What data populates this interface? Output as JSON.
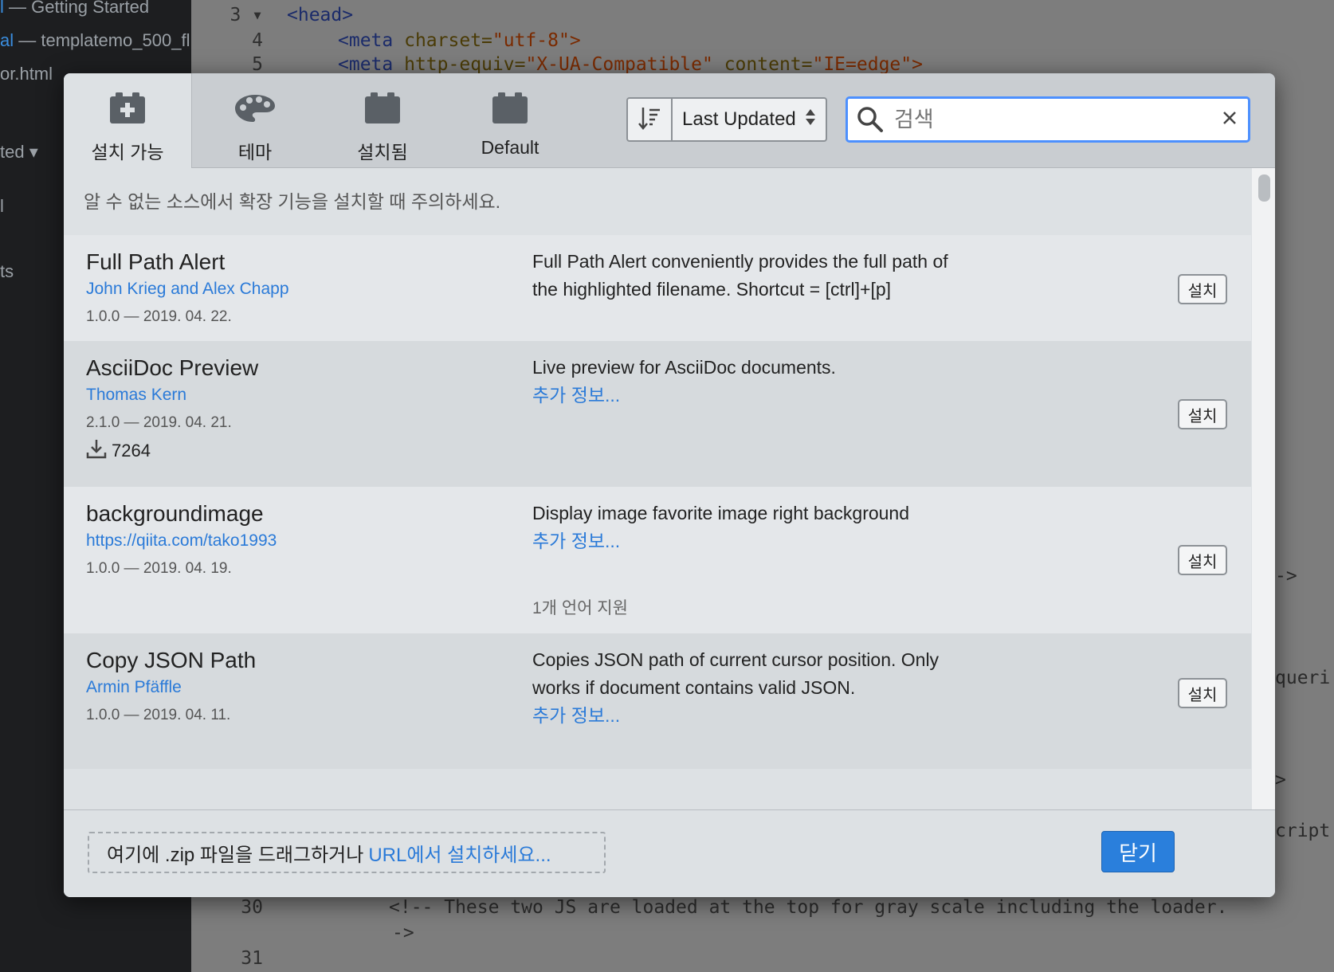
{
  "background": {
    "sidebar": [
      {
        "prefix": "l",
        "text": " — Getting Started"
      },
      {
        "prefix": "al",
        "text": " — templatemo_500_fl"
      },
      {
        "prefix": "",
        "text": "or.html"
      },
      {
        "prefix": "",
        "text": "ted ▾"
      },
      {
        "prefix": "",
        "text": "l"
      },
      {
        "prefix": "",
        "text": "ts"
      }
    ],
    "code": {
      "line3_num": "3 ▾",
      "line3": "<head>",
      "line4_num": "4",
      "line4_tag": "<meta",
      "line4_attr": "charset=",
      "line4_str": "\"utf-8\">",
      "line5_num": "5",
      "line5_tag": "<meta",
      "line5_attr": "http-equiv=",
      "line5_str1": "\"X-UA-Compatible\"",
      "line5_attr2": "content=",
      "line5_str2": "\"IE=edge\">",
      "line30_num": "30",
      "line30": "<!-- These two JS are loaded at the top for gray scale including the loader.",
      "line30b": "->",
      "line31_num": "31",
      "edge1": "->",
      "edge2": "queri",
      "edge3": ">",
      "edge4": "cript"
    }
  },
  "tabs": [
    {
      "label": "설치 가능",
      "icon": "add-package-icon",
      "active": true
    },
    {
      "label": "테마",
      "icon": "palette-icon",
      "active": false
    },
    {
      "label": "설치됨",
      "icon": "package-icon",
      "active": false
    },
    {
      "label": "Default",
      "icon": "package-icon",
      "active": false
    }
  ],
  "sort": {
    "selected": "Last Updated",
    "icon": "sort-descending-icon"
  },
  "search": {
    "placeholder": "검색",
    "value": ""
  },
  "warning": "알 수 없는 소스에서 확장 기능을 설치할 때 주의하세요.",
  "extensions": [
    {
      "name": "Full Path Alert",
      "author": "John Krieg and Alex Chapp",
      "version": "1.0.0 — 2019. 04. 22.",
      "description": "Full Path Alert conveniently provides the full path of the highlighted filename. Shortcut = [ctrl]+[p]",
      "install_label": "설치"
    },
    {
      "name": "AsciiDoc Preview",
      "author": "Thomas Kern",
      "version": "2.1.0 — 2019. 04. 21.",
      "downloads": "7264",
      "description": "Live preview for AsciiDoc documents.",
      "more": "추가 정보...",
      "install_label": "설치"
    },
    {
      "name": "backgroundimage",
      "author": "https://qiita.com/tako1993",
      "version": "1.0.0 — 2019. 04. 19.",
      "description": "Display image favorite image right background",
      "more": "추가 정보...",
      "languages": "1개 언어 지원",
      "install_label": "설치"
    },
    {
      "name": "Copy JSON Path",
      "author": "Armin Pfäffle",
      "version": "1.0.0 — 2019. 04. 11.",
      "description": "Copies JSON path of current cursor position. Only works if document contains valid JSON.",
      "more": "추가 정보...",
      "install_label": "설치"
    }
  ],
  "footer": {
    "drop_text": "여기에 .zip 파일을 드래그하거나",
    "url_link": "URL에서 설치하세요...",
    "close_label": "닫기"
  },
  "colors": {
    "accent": "#2a7fdc",
    "link": "#2a7ad8",
    "search_focus": "#4d90fe"
  }
}
